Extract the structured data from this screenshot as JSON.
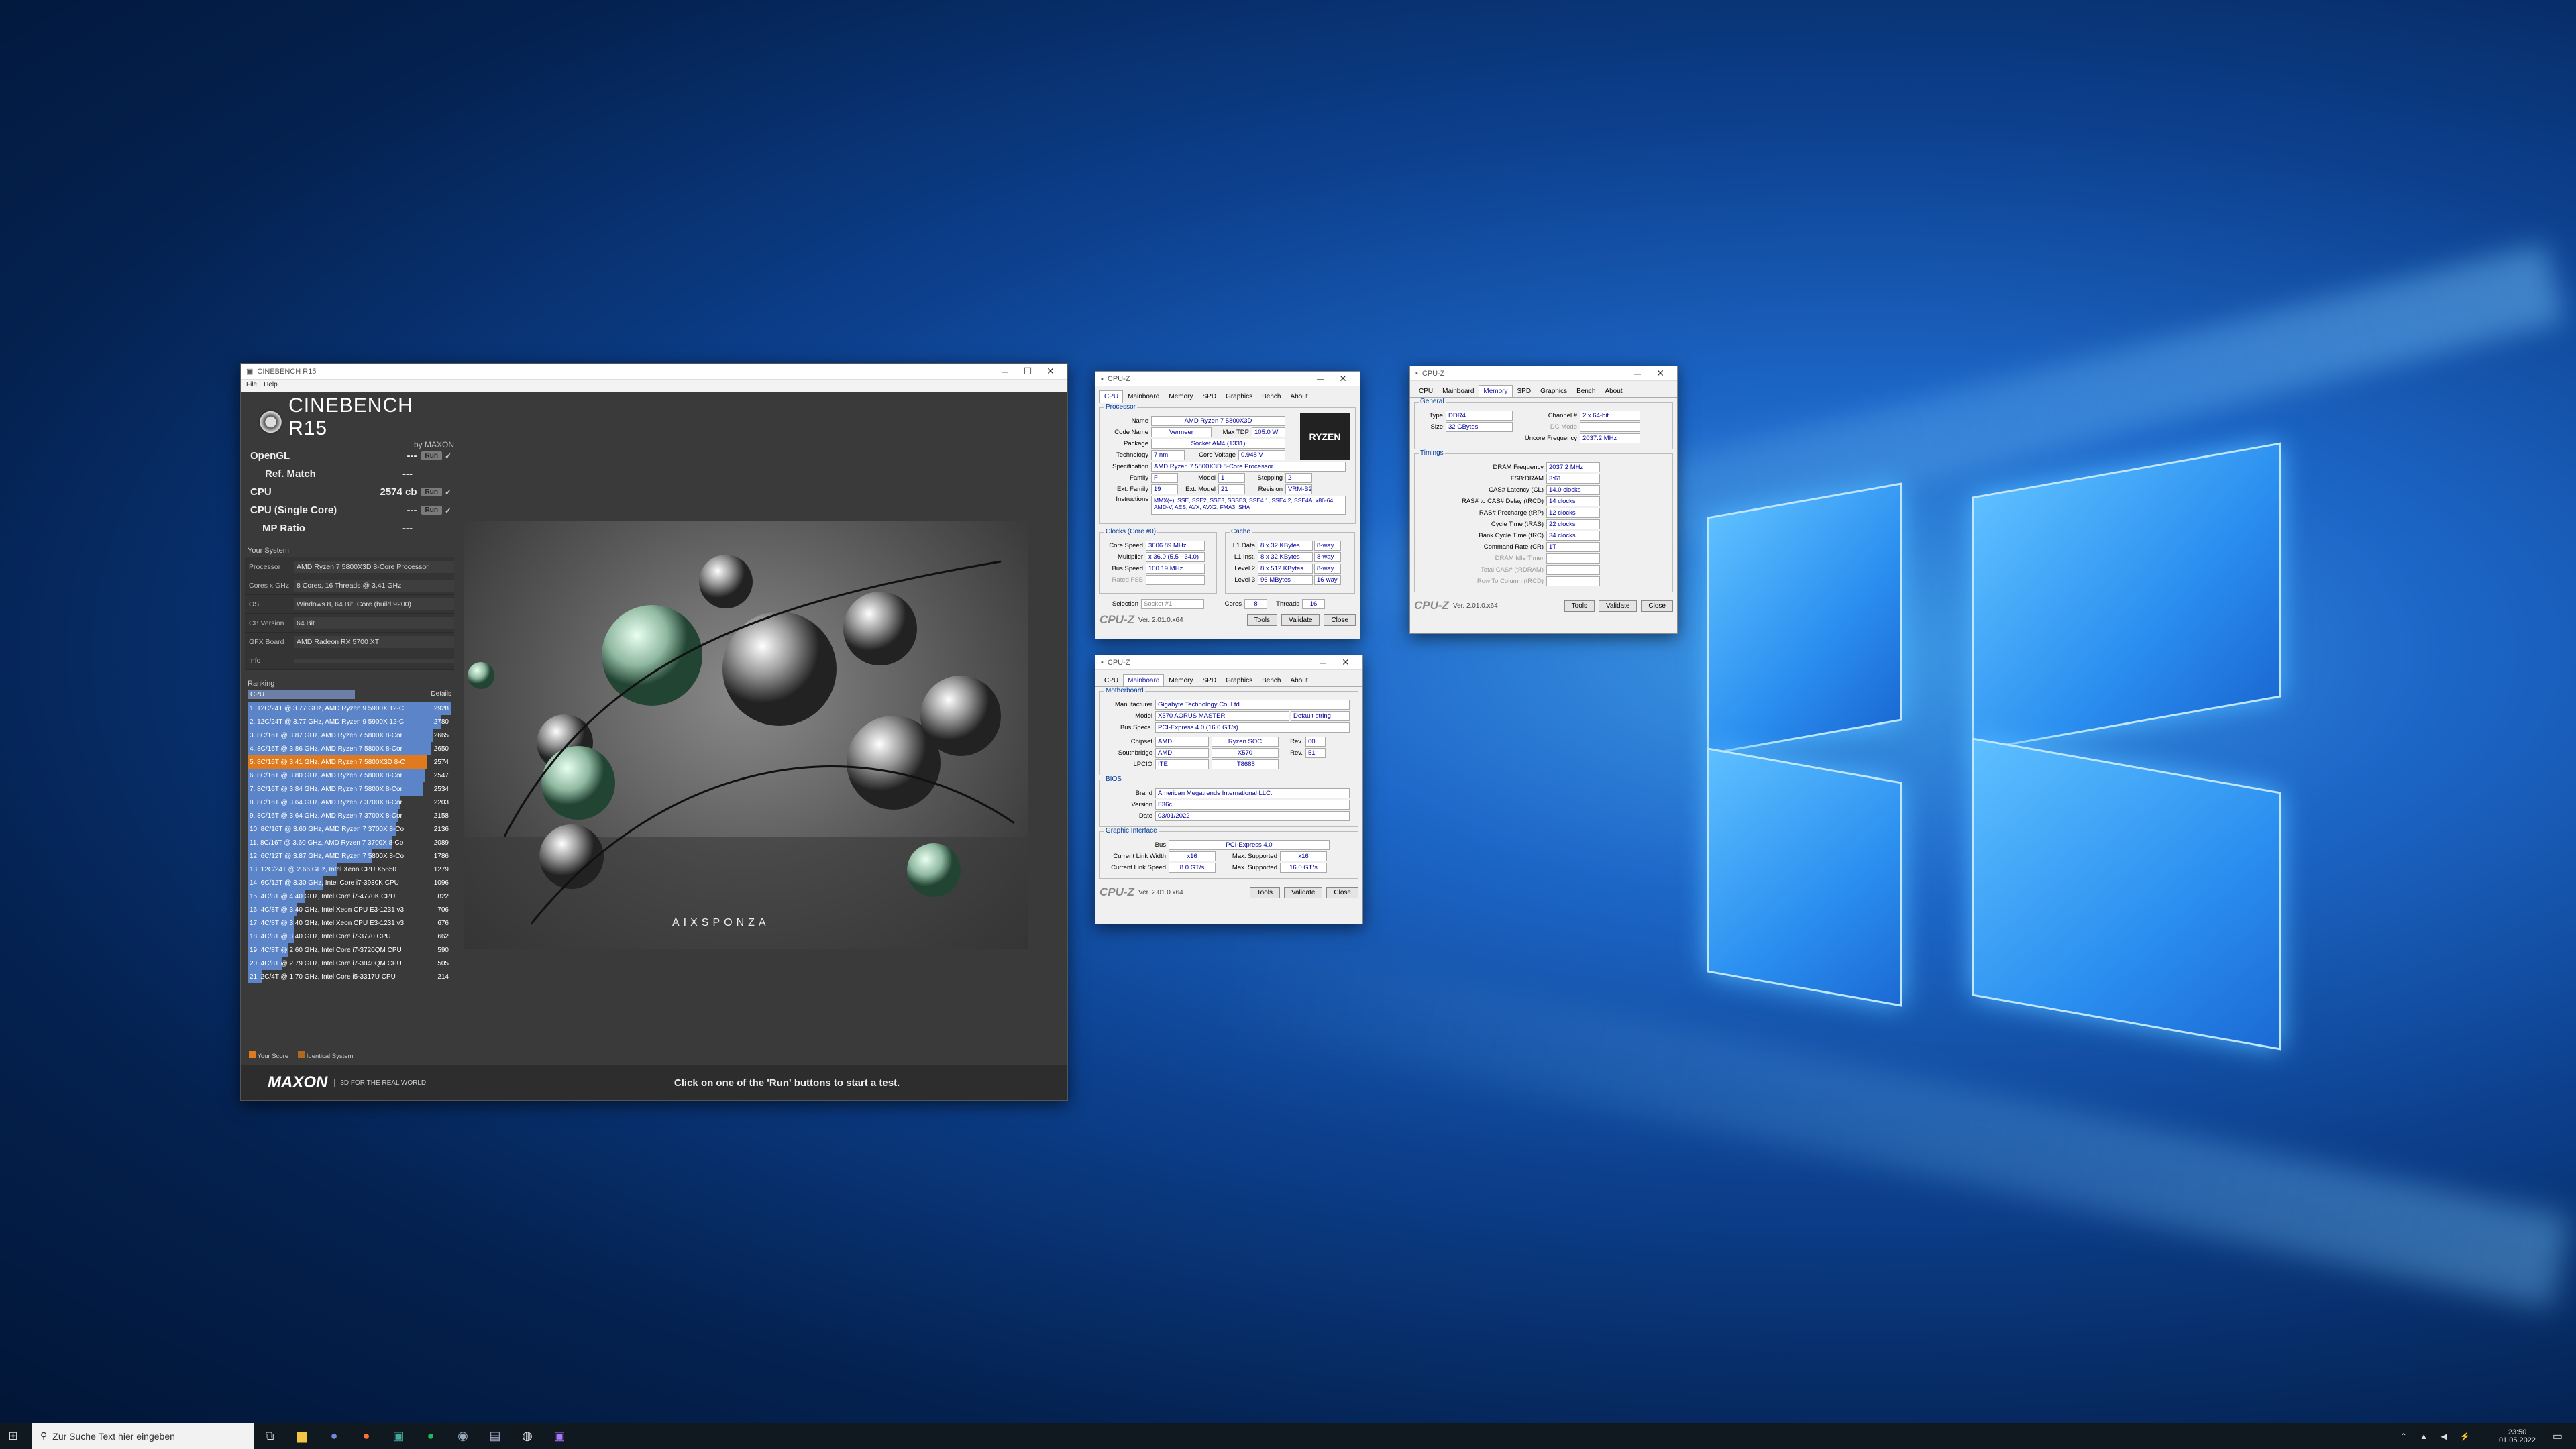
{
  "cinebench": {
    "title": "CINEBENCH R15",
    "menu": [
      "File",
      "Help"
    ],
    "logo": "CINEBENCH R15",
    "logo_sub": "by MAXON",
    "tests": [
      {
        "name": "OpenGL",
        "score": "---",
        "run": "Run",
        "check": "✓"
      },
      {
        "name": "Ref. Match",
        "score": "---",
        "run": "",
        "check": ""
      },
      {
        "name": "CPU",
        "score": "2574 cb",
        "run": "Run",
        "check": "✓"
      },
      {
        "name": "CPU (Single Core)",
        "score": "---",
        "run": "Run",
        "check": "✓"
      },
      {
        "name": "MP Ratio",
        "score": "---",
        "run": "",
        "check": ""
      }
    ],
    "your_system_label": "Your System",
    "system": [
      {
        "k": "Processor",
        "v": "AMD Ryzen 7 5800X3D 8-Core Processor"
      },
      {
        "k": "Cores x GHz",
        "v": "8 Cores, 16 Threads @ 3.41 GHz"
      },
      {
        "k": "OS",
        "v": "Windows 8, 64 Bit, Core (build 9200)"
      },
      {
        "k": "CB Version",
        "v": "64 Bit"
      },
      {
        "k": "GFX Board",
        "v": "AMD Radeon RX 5700 XT"
      },
      {
        "k": "Info",
        "v": ""
      }
    ],
    "ranking_label": "Ranking",
    "ranking_select": "CPU",
    "details": "Details",
    "ranking": [
      {
        "t": "1. 12C/24T @ 3.77 GHz, AMD Ryzen 9 5900X 12-C",
        "s": "2928",
        "c": "#5b85c8"
      },
      {
        "t": "2. 12C/24T @ 3.77 GHz, AMD Ryzen 9 5900X 12-C",
        "s": "2780",
        "c": "#5b85c8"
      },
      {
        "t": "3. 8C/16T @ 3.87 GHz, AMD Ryzen 7 5800X 8-Cor",
        "s": "2665",
        "c": "#5b85c8"
      },
      {
        "t": "4. 8C/16T @ 3.86 GHz, AMD Ryzen 7 5800X 8-Cor",
        "s": "2650",
        "c": "#5b85c8"
      },
      {
        "t": "5. 8C/16T @ 3.41 GHz, AMD Ryzen 7 5800X3D 8-C",
        "s": "2574",
        "c": "#e07a1f"
      },
      {
        "t": "6. 8C/16T @ 3.80 GHz, AMD Ryzen 7 5800X 8-Cor",
        "s": "2547",
        "c": "#5b85c8"
      },
      {
        "t": "7. 8C/16T @ 3.84 GHz, AMD Ryzen 7 5800X 8-Cor",
        "s": "2534",
        "c": "#5b85c8"
      },
      {
        "t": "8. 8C/16T @ 3.64 GHz, AMD Ryzen 7 3700X 8-Cor",
        "s": "2203",
        "c": "#5b85c8"
      },
      {
        "t": "9. 8C/16T @ 3.64 GHz, AMD Ryzen 7 3700X 8-Cor",
        "s": "2158",
        "c": "#5b85c8"
      },
      {
        "t": "10. 8C/16T @ 3.60 GHz, AMD Ryzen 7 3700X 8-Co",
        "s": "2136",
        "c": "#5b85c8"
      },
      {
        "t": "11. 8C/16T @ 3.60 GHz, AMD Ryzen 7 3700X 8-Co",
        "s": "2089",
        "c": "#5b85c8"
      },
      {
        "t": "12. 6C/12T @ 3.87 GHz, AMD Ryzen 7 5800X 8-Co",
        "s": "1786",
        "c": "#5b85c8"
      },
      {
        "t": "13. 12C/24T @ 2.66 GHz, Intel Xeon CPU X5650",
        "s": "1279",
        "c": "#5b85c8"
      },
      {
        "t": "14. 6C/12T @ 3.30 GHz, Intel Core i7-3930K CPU",
        "s": "1096",
        "c": "#5b85c8"
      },
      {
        "t": "15. 4C/8T @ 4.40 GHz, Intel Core i7-4770K CPU",
        "s": "822",
        "c": "#5b85c8"
      },
      {
        "t": "16. 4C/8T @ 3.40 GHz, Intel Xeon CPU E3-1231 v3",
        "s": "706",
        "c": "#5b85c8"
      },
      {
        "t": "17. 4C/8T @ 3.40 GHz, Intel Xeon CPU E3-1231 v3",
        "s": "676",
        "c": "#5b85c8"
      },
      {
        "t": "18. 4C/8T @ 3.40 GHz, Intel Core i7-3770 CPU",
        "s": "662",
        "c": "#5b85c8"
      },
      {
        "t": "19. 4C/8T @ 2.60 GHz, Intel Core i7-3720QM CPU",
        "s": "590",
        "c": "#5b85c8"
      },
      {
        "t": "20. 4C/8T @ 2.79 GHz, Intel Core i7-3840QM CPU",
        "s": "505",
        "c": "#5b85c8"
      },
      {
        "t": "21. 2C/4T @ 1.70 GHz, Intel Core i5-3317U CPU",
        "s": "214",
        "c": "#5b85c8"
      }
    ],
    "legend_your": "Your Score",
    "legend_ident": "Identical System",
    "maxon": "MAXON",
    "maxon_tag": "3D FOR THE REAL WORLD",
    "status": "Click on one of the 'Run' buttons to start a test.",
    "render_brand": "AIXSPONZA"
  },
  "cpuz_cpu": {
    "title": "CPU-Z",
    "tabs": [
      "CPU",
      "Mainboard",
      "Memory",
      "SPD",
      "Graphics",
      "Bench",
      "About"
    ],
    "processor_label": "Processor",
    "name": "AMD Ryzen 7 5800X3D",
    "code_name": "Vermeer",
    "max_tdp": "105.0 W",
    "package": "Socket AM4 (1331)",
    "technology": "7 nm",
    "core_voltage": "0.948 V",
    "specification": "AMD Ryzen 7 5800X3D 8-Core Processor",
    "family": "F",
    "model": "1",
    "stepping": "2",
    "ext_family": "19",
    "ext_model": "21",
    "revision": "VRM-B2",
    "instructions": "MMX(+), SSE, SSE2, SSE3, SSSE3, SSE4.1, SSE4.2, SSE4A, x86-64, AMD-V, AES, AVX, AVX2, FMA3, SHA",
    "clocks_label": "Clocks (Core #0)",
    "cache_label": "Cache",
    "core_speed": "3606.89 MHz",
    "multiplier": "x 36.0 (5.5 - 34.0)",
    "bus_speed": "100.19 MHz",
    "rated_fsb": "",
    "l1d": "8 x 32 KBytes",
    "l1d_w": "8-way",
    "l1i": "8 x 32 KBytes",
    "l1i_w": "8-way",
    "l2": "8 x 512 KBytes",
    "l2_w": "8-way",
    "l3": "96 MBytes",
    "l3_w": "16-way",
    "selection": "Socket #1",
    "cores": "8",
    "threads": "16",
    "version": "Ver. 2.01.0.x64",
    "tools": "Tools",
    "validate": "Validate",
    "close": "Close",
    "logo": "RYZEN"
  },
  "cpuz_mb": {
    "title": "CPU-Z",
    "motherboard_label": "Motherboard",
    "manufacturer": "Gigabyte Technology Co. Ltd.",
    "model": "X570 AORUS MASTER",
    "model_rev": "Default string",
    "bus_specs": "PCI-Express 4.0 (16.0 GT/s)",
    "chipset": "AMD",
    "chipset_v": "Ryzen SOC",
    "chipset_rev": "00",
    "southbridge": "AMD",
    "southbridge_v": "X570",
    "southbridge_rev": "51",
    "lpcio": "ITE",
    "lpcio_v": "IT8688",
    "bios_label": "BIOS",
    "brand": "American Megatrends International LLC.",
    "bios_version": "F36c",
    "date": "03/01/2022",
    "gi_label": "Graphic Interface",
    "gi_bus": "PCI-Express 4.0",
    "link_width": "x16",
    "max_width": "x16",
    "link_speed": "8.0 GT/s",
    "max_speed": "16.0 GT/s"
  },
  "cpuz_mem": {
    "title": "CPU-Z",
    "general_label": "General",
    "type": "DDR4",
    "size": "32 GBytes",
    "channel": "2 x 64-bit",
    "dc_mode": "",
    "uncore": "2037.2 MHz",
    "timings_label": "Timings",
    "timings": [
      {
        "k": "DRAM Frequency",
        "v": "2037.2 MHz"
      },
      {
        "k": "FSB:DRAM",
        "v": "3:61"
      },
      {
        "k": "CAS# Latency (CL)",
        "v": "14.0 clocks"
      },
      {
        "k": "RAS# to CAS# Delay (tRCD)",
        "v": "14 clocks"
      },
      {
        "k": "RAS# Precharge (tRP)",
        "v": "12 clocks"
      },
      {
        "k": "Cycle Time (tRAS)",
        "v": "22 clocks"
      },
      {
        "k": "Bank Cycle Time (tRC)",
        "v": "34 clocks"
      },
      {
        "k": "Command Rate (CR)",
        "v": "1T"
      },
      {
        "k": "DRAM Idle Timer",
        "v": ""
      },
      {
        "k": "Total CAS# (tRDRAM)",
        "v": ""
      },
      {
        "k": "Row To Column (tRCD)",
        "v": ""
      }
    ]
  },
  "taskbar": {
    "search": "Zur Suche Text hier eingeben",
    "time": "23:50",
    "date": "01.05.2022"
  }
}
